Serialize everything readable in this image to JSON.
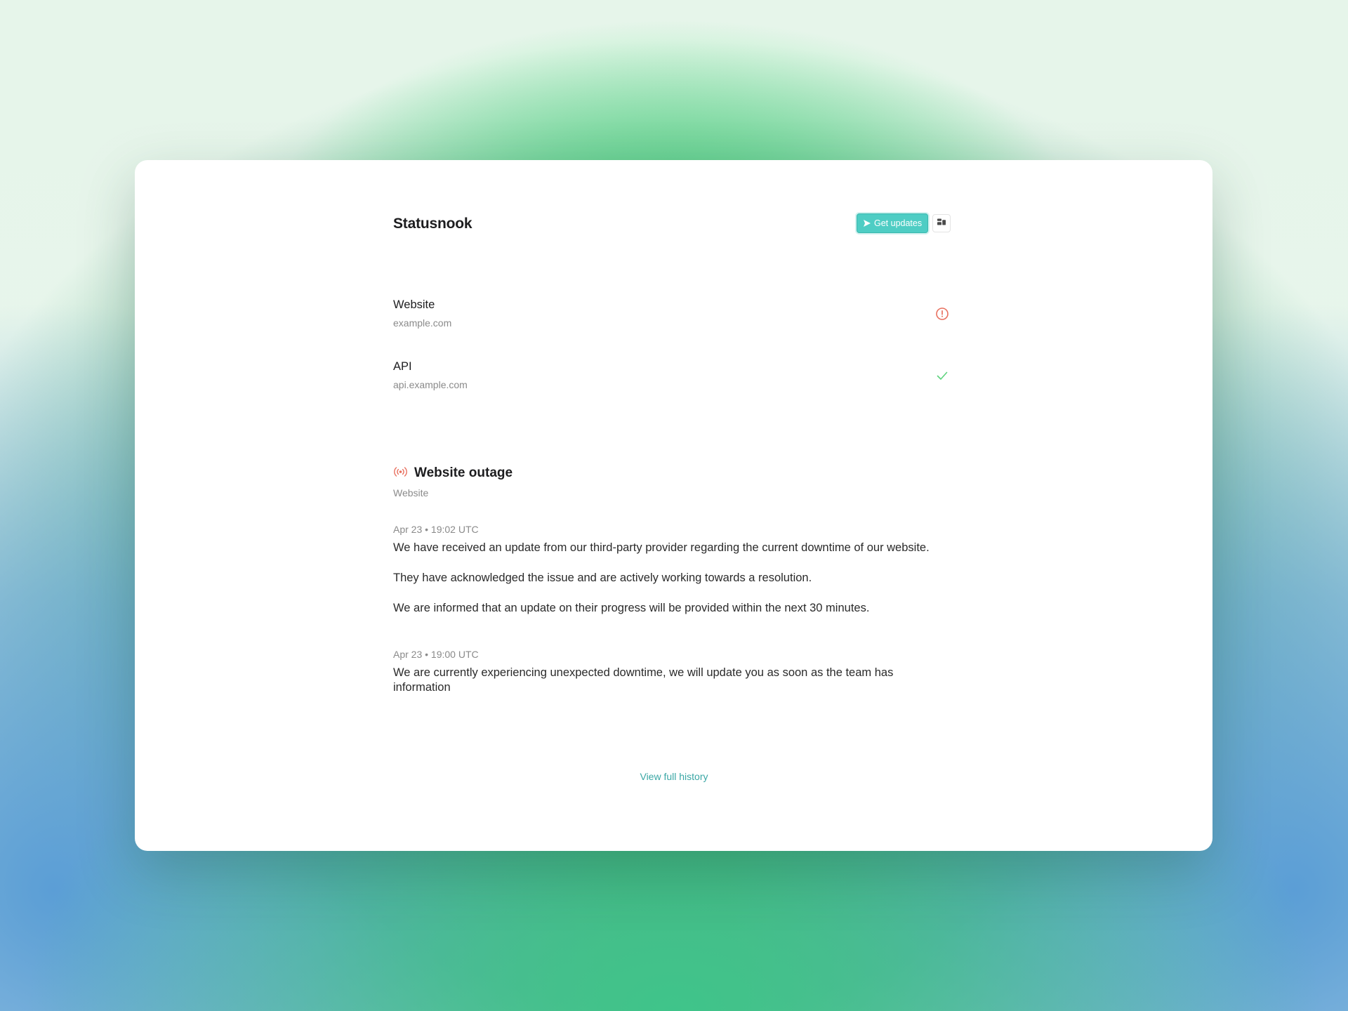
{
  "header": {
    "brand": "Statusnook",
    "get_updates_label": "Get updates"
  },
  "services": [
    {
      "name": "Website",
      "host": "example.com",
      "status": "outage",
      "status_icon": "alert-circle-icon"
    },
    {
      "name": "API",
      "host": "api.example.com",
      "status": "operational",
      "status_icon": "check-icon"
    }
  ],
  "incident": {
    "title": "Website outage",
    "affected": "Website",
    "updates": [
      {
        "time": "Apr 23 • 19:02 UTC",
        "paragraphs": [
          "We have received an update from our third-party provider regarding the current downtime of our website.",
          "They have acknowledged the issue and are actively working towards a resolution.",
          "We are informed that an update on their progress will be provided within the next 30 minutes."
        ]
      },
      {
        "time": "Apr 23 • 19:00 UTC",
        "paragraphs": [
          "We are currently experiencing unexpected downtime, we will update you as soon as the team has information"
        ]
      }
    ]
  },
  "footer": {
    "history_link": "View full history"
  },
  "colors": {
    "accent": "#4ecdc4",
    "outage": "#e8705f",
    "operational": "#5ed37e",
    "link": "#3aa7a5"
  }
}
